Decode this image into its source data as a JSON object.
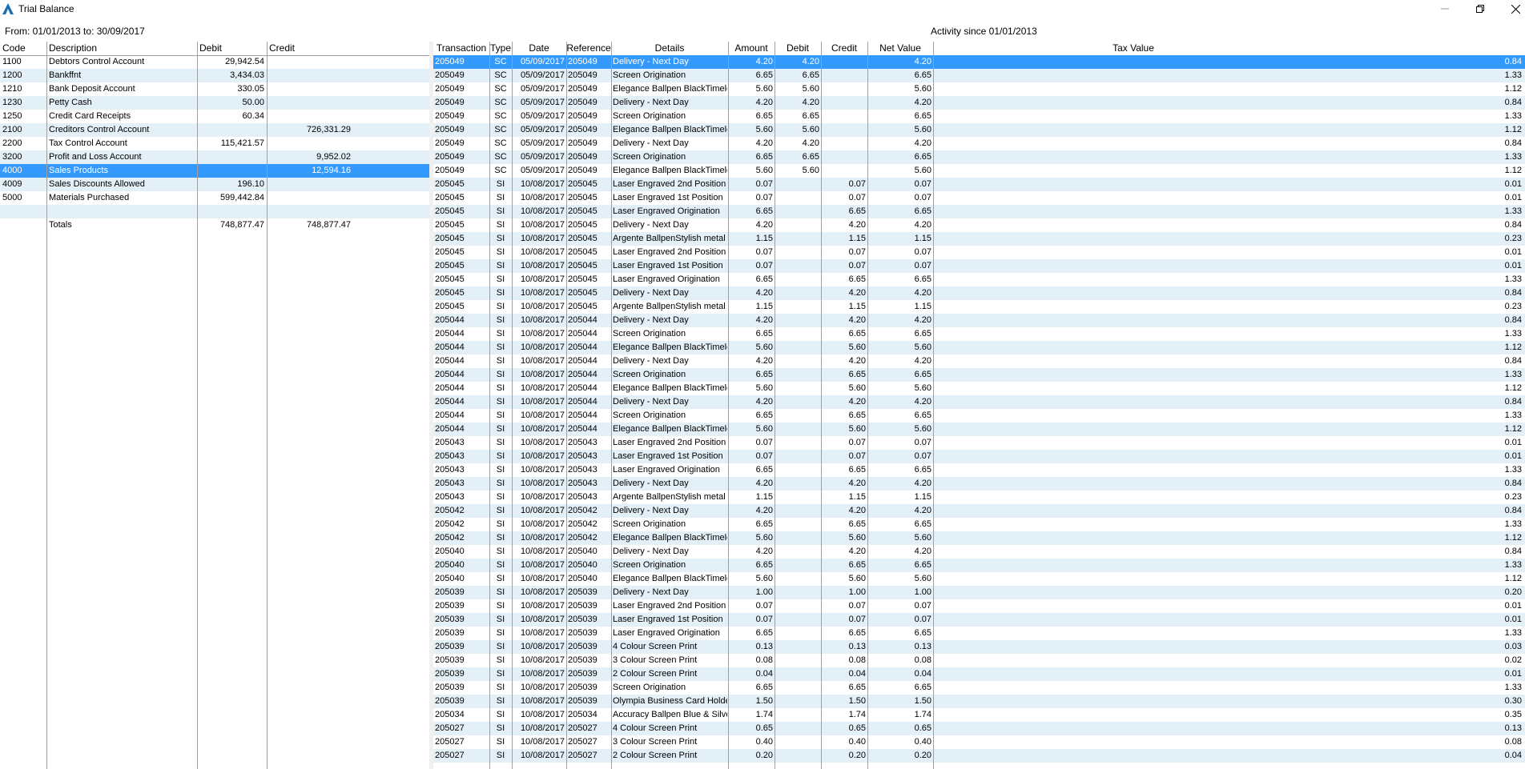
{
  "window": {
    "title": "Trial Balance",
    "date_range": "From: 01/01/2013 to: 30/09/2017",
    "activity_label": "Activity since 01/01/2013"
  },
  "icons": [
    "app-logo-icon",
    "minimize-icon",
    "restore-icon",
    "close-icon"
  ],
  "colors": {
    "selection": "#3399ff",
    "alt_row": "#e4f0f8",
    "logo": "#1a6fb4"
  },
  "left": {
    "headers": [
      "Code",
      "Description",
      "Debit",
      "Credit"
    ],
    "selected_index": 8,
    "rows": [
      {
        "code": "1100",
        "desc": "Debtors Control Account",
        "debit": "29,942.54",
        "credit": ""
      },
      {
        "code": "1200",
        "desc": "Bankffnt",
        "debit": "3,434.03",
        "credit": ""
      },
      {
        "code": "1210",
        "desc": "Bank Deposit Account",
        "debit": "330.05",
        "credit": ""
      },
      {
        "code": "1230",
        "desc": "Petty Cash",
        "debit": "50.00",
        "credit": ""
      },
      {
        "code": "1250",
        "desc": "Credit Card Receipts",
        "debit": "60.34",
        "credit": ""
      },
      {
        "code": "2100",
        "desc": "Creditors Control Account",
        "debit": "",
        "credit": "726,331.29"
      },
      {
        "code": "2200",
        "desc": "Tax Control Account",
        "debit": "115,421.57",
        "credit": ""
      },
      {
        "code": "3200",
        "desc": "Profit and Loss Account",
        "debit": "",
        "credit": "9,952.02"
      },
      {
        "code": "4000",
        "desc": "Sales Products",
        "debit": "",
        "credit": "12,594.16"
      },
      {
        "code": "4009",
        "desc": "Sales Discounts Allowed",
        "debit": "196.10",
        "credit": ""
      },
      {
        "code": "5000",
        "desc": "Materials Purchased",
        "debit": "599,442.84",
        "credit": ""
      },
      {
        "code": "",
        "desc": "",
        "debit": "",
        "credit": ""
      },
      {
        "code": "",
        "desc": "Totals",
        "debit": "748,877.47",
        "credit": "748,877.47"
      }
    ]
  },
  "right": {
    "headers": [
      "Transaction",
      "Type",
      "Date",
      "Reference",
      "Details",
      "Amount",
      "Debit",
      "Credit",
      "Net Value",
      "Tax Value"
    ],
    "selected_index": 0,
    "rows": [
      [
        "205049",
        "SC",
        "05/09/2017",
        "205049",
        "Delivery - Next Day",
        "4.20",
        "4.20",
        "",
        "4.20",
        "0.84"
      ],
      [
        "205049",
        "SC",
        "05/09/2017",
        "205049",
        "Screen Origination",
        "6.65",
        "6.65",
        "",
        "6.65",
        "1.33"
      ],
      [
        "205049",
        "SC",
        "05/09/2017",
        "205049",
        "Elegance Ballpen BlackTimeles",
        "5.60",
        "5.60",
        "",
        "5.60",
        "1.12"
      ],
      [
        "205049",
        "SC",
        "05/09/2017",
        "205049",
        "Delivery - Next Day",
        "4.20",
        "4.20",
        "",
        "4.20",
        "0.84"
      ],
      [
        "205049",
        "SC",
        "05/09/2017",
        "205049",
        "Screen Origination",
        "6.65",
        "6.65",
        "",
        "6.65",
        "1.33"
      ],
      [
        "205049",
        "SC",
        "05/09/2017",
        "205049",
        "Elegance Ballpen BlackTimeles",
        "5.60",
        "5.60",
        "",
        "5.60",
        "1.12"
      ],
      [
        "205049",
        "SC",
        "05/09/2017",
        "205049",
        "Delivery - Next Day",
        "4.20",
        "4.20",
        "",
        "4.20",
        "0.84"
      ],
      [
        "205049",
        "SC",
        "05/09/2017",
        "205049",
        "Screen Origination",
        "6.65",
        "6.65",
        "",
        "6.65",
        "1.33"
      ],
      [
        "205049",
        "SC",
        "05/09/2017",
        "205049",
        "Elegance Ballpen BlackTimeles",
        "5.60",
        "5.60",
        "",
        "5.60",
        "1.12"
      ],
      [
        "205045",
        "SI",
        "10/08/2017",
        "205045",
        "Laser Engraved 2nd Position",
        "0.07",
        "",
        "0.07",
        "0.07",
        "0.01"
      ],
      [
        "205045",
        "SI",
        "10/08/2017",
        "205045",
        "Laser Engraved 1st Position",
        "0.07",
        "",
        "0.07",
        "0.07",
        "0.01"
      ],
      [
        "205045",
        "SI",
        "10/08/2017",
        "205045",
        "Laser Engraved Origination",
        "6.65",
        "",
        "6.65",
        "6.65",
        "1.33"
      ],
      [
        "205045",
        "SI",
        "10/08/2017",
        "205045",
        "Delivery - Next Day",
        "4.20",
        "",
        "4.20",
        "4.20",
        "0.84"
      ],
      [
        "205045",
        "SI",
        "10/08/2017",
        "205045",
        "Argente BallpenStylish metal ba",
        "1.15",
        "",
        "1.15",
        "1.15",
        "0.23"
      ],
      [
        "205045",
        "SI",
        "10/08/2017",
        "205045",
        "Laser Engraved 2nd Position",
        "0.07",
        "",
        "0.07",
        "0.07",
        "0.01"
      ],
      [
        "205045",
        "SI",
        "10/08/2017",
        "205045",
        "Laser Engraved 1st Position",
        "0.07",
        "",
        "0.07",
        "0.07",
        "0.01"
      ],
      [
        "205045",
        "SI",
        "10/08/2017",
        "205045",
        "Laser Engraved Origination",
        "6.65",
        "",
        "6.65",
        "6.65",
        "1.33"
      ],
      [
        "205045",
        "SI",
        "10/08/2017",
        "205045",
        "Delivery - Next Day",
        "4.20",
        "",
        "4.20",
        "4.20",
        "0.84"
      ],
      [
        "205045",
        "SI",
        "10/08/2017",
        "205045",
        "Argente BallpenStylish metal ba",
        "1.15",
        "",
        "1.15",
        "1.15",
        "0.23"
      ],
      [
        "205044",
        "SI",
        "10/08/2017",
        "205044",
        "Delivery - Next Day",
        "4.20",
        "",
        "4.20",
        "4.20",
        "0.84"
      ],
      [
        "205044",
        "SI",
        "10/08/2017",
        "205044",
        "Screen Origination",
        "6.65",
        "",
        "6.65",
        "6.65",
        "1.33"
      ],
      [
        "205044",
        "SI",
        "10/08/2017",
        "205044",
        "Elegance Ballpen BlackTimeles",
        "5.60",
        "",
        "5.60",
        "5.60",
        "1.12"
      ],
      [
        "205044",
        "SI",
        "10/08/2017",
        "205044",
        "Delivery - Next Day",
        "4.20",
        "",
        "4.20",
        "4.20",
        "0.84"
      ],
      [
        "205044",
        "SI",
        "10/08/2017",
        "205044",
        "Screen Origination",
        "6.65",
        "",
        "6.65",
        "6.65",
        "1.33"
      ],
      [
        "205044",
        "SI",
        "10/08/2017",
        "205044",
        "Elegance Ballpen BlackTimeles",
        "5.60",
        "",
        "5.60",
        "5.60",
        "1.12"
      ],
      [
        "205044",
        "SI",
        "10/08/2017",
        "205044",
        "Delivery - Next Day",
        "4.20",
        "",
        "4.20",
        "4.20",
        "0.84"
      ],
      [
        "205044",
        "SI",
        "10/08/2017",
        "205044",
        "Screen Origination",
        "6.65",
        "",
        "6.65",
        "6.65",
        "1.33"
      ],
      [
        "205044",
        "SI",
        "10/08/2017",
        "205044",
        "Elegance Ballpen BlackTimeles",
        "5.60",
        "",
        "5.60",
        "5.60",
        "1.12"
      ],
      [
        "205043",
        "SI",
        "10/08/2017",
        "205043",
        "Laser Engraved 2nd Position",
        "0.07",
        "",
        "0.07",
        "0.07",
        "0.01"
      ],
      [
        "205043",
        "SI",
        "10/08/2017",
        "205043",
        "Laser Engraved 1st Position",
        "0.07",
        "",
        "0.07",
        "0.07",
        "0.01"
      ],
      [
        "205043",
        "SI",
        "10/08/2017",
        "205043",
        "Laser Engraved Origination",
        "6.65",
        "",
        "6.65",
        "6.65",
        "1.33"
      ],
      [
        "205043",
        "SI",
        "10/08/2017",
        "205043",
        "Delivery - Next Day",
        "4.20",
        "",
        "4.20",
        "4.20",
        "0.84"
      ],
      [
        "205043",
        "SI",
        "10/08/2017",
        "205043",
        "Argente BallpenStylish metal ba",
        "1.15",
        "",
        "1.15",
        "1.15",
        "0.23"
      ],
      [
        "205042",
        "SI",
        "10/08/2017",
        "205042",
        "Delivery - Next Day",
        "4.20",
        "",
        "4.20",
        "4.20",
        "0.84"
      ],
      [
        "205042",
        "SI",
        "10/08/2017",
        "205042",
        "Screen Origination",
        "6.65",
        "",
        "6.65",
        "6.65",
        "1.33"
      ],
      [
        "205042",
        "SI",
        "10/08/2017",
        "205042",
        "Elegance Ballpen BlackTimeles",
        "5.60",
        "",
        "5.60",
        "5.60",
        "1.12"
      ],
      [
        "205040",
        "SI",
        "10/08/2017",
        "205040",
        "Delivery - Next Day",
        "4.20",
        "",
        "4.20",
        "4.20",
        "0.84"
      ],
      [
        "205040",
        "SI",
        "10/08/2017",
        "205040",
        "Screen Origination",
        "6.65",
        "",
        "6.65",
        "6.65",
        "1.33"
      ],
      [
        "205040",
        "SI",
        "10/08/2017",
        "205040",
        "Elegance Ballpen BlackTimeles",
        "5.60",
        "",
        "5.60",
        "5.60",
        "1.12"
      ],
      [
        "205039",
        "SI",
        "10/08/2017",
        "205039",
        "Delivery - Next Day",
        "1.00",
        "",
        "1.00",
        "1.00",
        "0.20"
      ],
      [
        "205039",
        "SI",
        "10/08/2017",
        "205039",
        "Laser Engraved 2nd Position",
        "0.07",
        "",
        "0.07",
        "0.07",
        "0.01"
      ],
      [
        "205039",
        "SI",
        "10/08/2017",
        "205039",
        "Laser Engraved 1st Position",
        "0.07",
        "",
        "0.07",
        "0.07",
        "0.01"
      ],
      [
        "205039",
        "SI",
        "10/08/2017",
        "205039",
        "Laser Engraved Origination",
        "6.65",
        "",
        "6.65",
        "6.65",
        "1.33"
      ],
      [
        "205039",
        "SI",
        "10/08/2017",
        "205039",
        "4 Colour Screen Print",
        "0.13",
        "",
        "0.13",
        "0.13",
        "0.03"
      ],
      [
        "205039",
        "SI",
        "10/08/2017",
        "205039",
        "3 Colour Screen Print",
        "0.08",
        "",
        "0.08",
        "0.08",
        "0.02"
      ],
      [
        "205039",
        "SI",
        "10/08/2017",
        "205039",
        "2 Colour Screen Print",
        "0.04",
        "",
        "0.04",
        "0.04",
        "0.01"
      ],
      [
        "205039",
        "SI",
        "10/08/2017",
        "205039",
        "Screen Origination",
        "6.65",
        "",
        "6.65",
        "6.65",
        "1.33"
      ],
      [
        "205039",
        "SI",
        "10/08/2017",
        "205039",
        "Olympia Business Card HolderE",
        "1.50",
        "",
        "1.50",
        "1.50",
        "0.30"
      ],
      [
        "205034",
        "SI",
        "10/08/2017",
        "205034",
        "Accuracy Ballpen Blue & SilverS",
        "1.74",
        "",
        "1.74",
        "1.74",
        "0.35"
      ],
      [
        "205027",
        "SI",
        "10/08/2017",
        "205027",
        "4 Colour Screen Print",
        "0.65",
        "",
        "0.65",
        "0.65",
        "0.13"
      ],
      [
        "205027",
        "SI",
        "10/08/2017",
        "205027",
        "3 Colour Screen Print",
        "0.40",
        "",
        "0.40",
        "0.40",
        "0.08"
      ],
      [
        "205027",
        "SI",
        "10/08/2017",
        "205027",
        "2 Colour Screen Print",
        "0.20",
        "",
        "0.20",
        "0.20",
        "0.04"
      ]
    ]
  }
}
